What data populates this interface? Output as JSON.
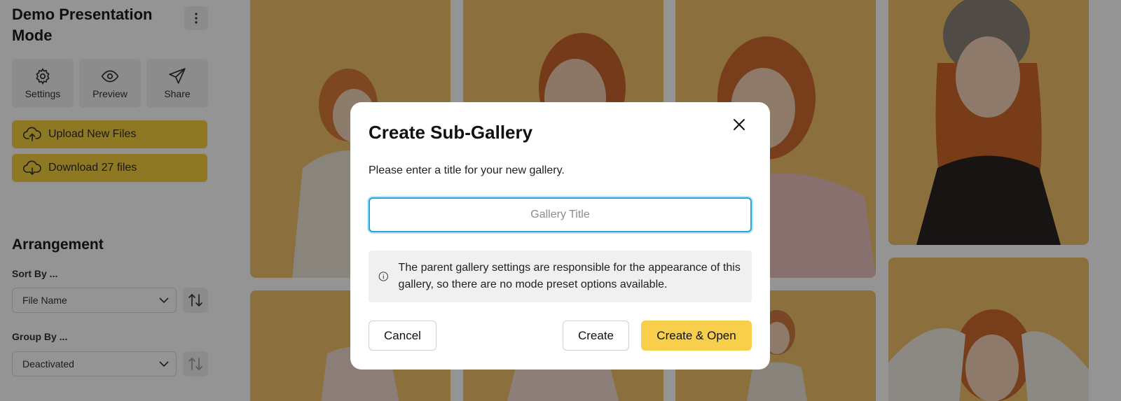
{
  "sidebar": {
    "title": "Demo Presentation Mode",
    "tools": [
      {
        "label": "Settings",
        "icon": "gear-icon"
      },
      {
        "label": "Preview",
        "icon": "eye-icon"
      },
      {
        "label": "Share",
        "icon": "send-icon"
      }
    ],
    "upload_label": "Upload New Files",
    "download_label": "Download 27 files",
    "arrangement": {
      "title": "Arrangement",
      "sort_label": "Sort By ...",
      "sort_value": "File Name",
      "group_label": "Group By ...",
      "group_value": "Deactivated"
    }
  },
  "modal": {
    "title": "Create Sub-Gallery",
    "description": "Please enter a title for your new gallery.",
    "input_placeholder": "Gallery Title",
    "input_value": "",
    "info_text": "The parent gallery settings are responsible for the appearance of this gallery, so there are no mode preset options available.",
    "cancel_label": "Cancel",
    "create_label": "Create",
    "create_open_label": "Create & Open"
  },
  "colors": {
    "accent": "#f7cf4a",
    "focus": "#2aa3d6",
    "tile_bg": "#f0c16a",
    "overlay": "rgba(0,0,0,0.42)"
  }
}
